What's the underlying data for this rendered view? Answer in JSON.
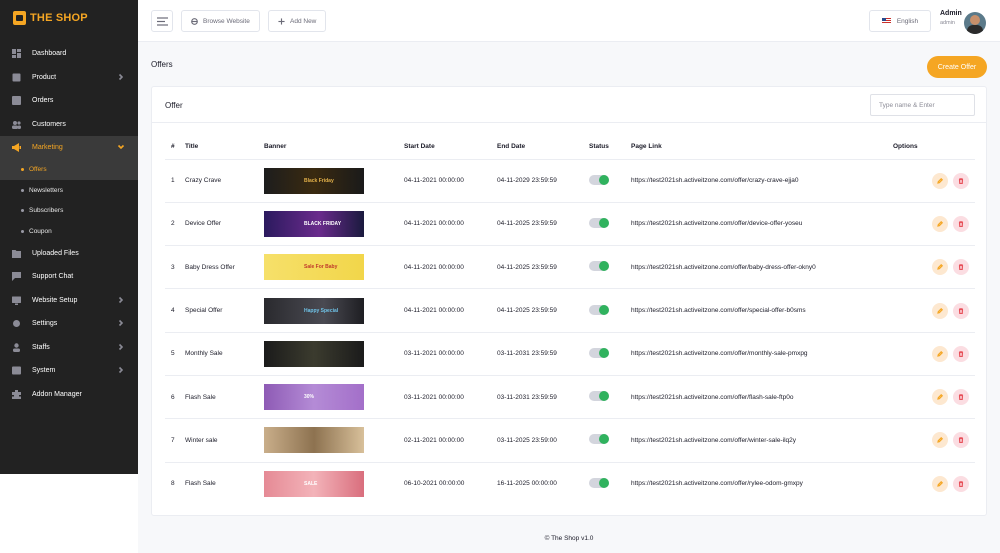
{
  "brand": {
    "name": "THE SHOP"
  },
  "sidebar": {
    "items": [
      {
        "label": "Dashboard",
        "icon": "dashboard-icon",
        "has_children": false
      },
      {
        "label": "Product",
        "icon": "product-icon",
        "has_children": true
      },
      {
        "label": "Orders",
        "icon": "orders-icon",
        "has_children": false
      },
      {
        "label": "Customers",
        "icon": "customers-icon",
        "has_children": false
      },
      {
        "label": "Marketing",
        "icon": "marketing-icon",
        "has_children": true,
        "active": true
      }
    ],
    "marketing_sub": [
      "Offers",
      "Newsletters",
      "Subscribers",
      "Coupon"
    ],
    "items_after": [
      {
        "label": "Uploaded Files",
        "icon": "uploaded-files-icon",
        "has_children": false
      },
      {
        "label": "Support Chat",
        "icon": "support-chat-icon",
        "has_children": false
      },
      {
        "label": "Website Setup",
        "icon": "website-setup-icon",
        "has_children": true
      },
      {
        "label": "Settings",
        "icon": "settings-icon",
        "has_children": true
      },
      {
        "label": "Staffs",
        "icon": "staffs-icon",
        "has_children": true
      },
      {
        "label": "System",
        "icon": "system-icon",
        "has_children": true
      },
      {
        "label": "Addon Manager",
        "icon": "addon-manager-icon",
        "has_children": false
      }
    ]
  },
  "topbar": {
    "browse_label": "Browse Website",
    "add_label": "Add New",
    "language": "English",
    "admin_name": "Admin",
    "admin_role": "admin"
  },
  "page": {
    "title": "Offers",
    "create_label": "Create Offer",
    "card_title": "Offer",
    "search_placeholder": "Type name & Enter"
  },
  "table": {
    "headers": [
      "#",
      "Title",
      "Banner",
      "Start Date",
      "End Date",
      "Status",
      "Page Link",
      "Options"
    ],
    "rows": [
      {
        "num": "1",
        "title": "Crazy Crave",
        "start": "04-11-2021 00:00:00",
        "end": "04-11-2029 23:59:59",
        "status": "on",
        "link": "https://test2021sh.activeitzone.com/offer/crazy-crave-ejja0"
      },
      {
        "num": "2",
        "title": "Device Offer",
        "start": "04-11-2021 00:00:00",
        "end": "04-11-2025 23:59:59",
        "status": "on",
        "link": "https://test2021sh.activeitzone.com/offer/device-offer-yoseu"
      },
      {
        "num": "3",
        "title": "Baby Dress Offer",
        "start": "04-11-2021 00:00:00",
        "end": "04-11-2025 23:59:59",
        "status": "on",
        "link": "https://test2021sh.activeitzone.com/offer/baby-dress-offer-okny0"
      },
      {
        "num": "4",
        "title": "Special Offer",
        "start": "04-11-2021 00:00:00",
        "end": "04-11-2025 23:59:59",
        "status": "on",
        "link": "https://test2021sh.activeitzone.com/offer/special-offer-b0sms"
      },
      {
        "num": "5",
        "title": "Monthly Sale",
        "start": "03-11-2021 00:00:00",
        "end": "03-11-2031 23:59:59",
        "status": "on",
        "link": "https://test2021sh.activeitzone.com/offer/monthly-sale-pmxpg"
      },
      {
        "num": "6",
        "title": "Flash Sale",
        "start": "03-11-2021 00:00:00",
        "end": "03-11-2031 23:59:59",
        "status": "on",
        "link": "https://test2021sh.activeitzone.com/offer/flash-sale-ftp0o"
      },
      {
        "num": "7",
        "title": "Winter sale",
        "start": "02-11-2021 00:00:00",
        "end": "03-11-2025 23:59:00",
        "status": "on",
        "link": "https://test2021sh.activeitzone.com/offer/winter-sale-ilq2y"
      },
      {
        "num": "8",
        "title": "Flash Sale",
        "start": "06-10-2021 00:00:00",
        "end": "16-11-2025 00:00:00",
        "status": "on",
        "link": "https://test2021sh.activeitzone.com/offer/rylee-odom-gmxpy"
      }
    ]
  },
  "banners": [
    {
      "bg": "linear-gradient(90deg,#1d1d1d 0%,#3a2a10 50%,#1a1a1a 100%)",
      "text": "Black Friday",
      "text_color": "#e3b14a"
    },
    {
      "bg": "linear-gradient(90deg,#2b1a5e 0%,#6a2b8c 55%,#1a1a3e 100%)",
      "text": "BLACK FRIDAY",
      "text_color": "#ffffff"
    },
    {
      "bg": "linear-gradient(90deg,#f6e06a 0%,#f2d64a 100%)",
      "text": "Sale For Baby",
      "text_color": "#c0392b"
    },
    {
      "bg": "linear-gradient(90deg,#2a2a2e 0%,#4a4a52 60%,#1e1e22 100%)",
      "text": "Happy Special",
      "text_color": "#6fc3e8"
    },
    {
      "bg": "linear-gradient(90deg,#1b1b1b 0%,#3b3b2e 50%,#1b1b1b 100%)",
      "text": "",
      "text_color": "#f5c32b"
    },
    {
      "bg": "linear-gradient(90deg,#8e5bb5 0%,#b48bd6 50%,#a36fc9 100%)",
      "text": "30%",
      "text_color": "#ffffff"
    },
    {
      "bg": "linear-gradient(90deg,#c9ae8a 0%,#8d7250 50%,#d8c09a 100%)",
      "text": "",
      "text_color": "#ffffff"
    },
    {
      "bg": "linear-gradient(90deg,#e58a95 0%,#f3b3b9 50%,#d96e7d 100%)",
      "text": "SALE",
      "text_color": "#ffffff"
    }
  ],
  "footer": {
    "text": "© The Shop v1.0"
  },
  "colors": {
    "accent": "#f5a623",
    "sidebar_bg": "#222222",
    "toggle_on": "#30b25e"
  }
}
